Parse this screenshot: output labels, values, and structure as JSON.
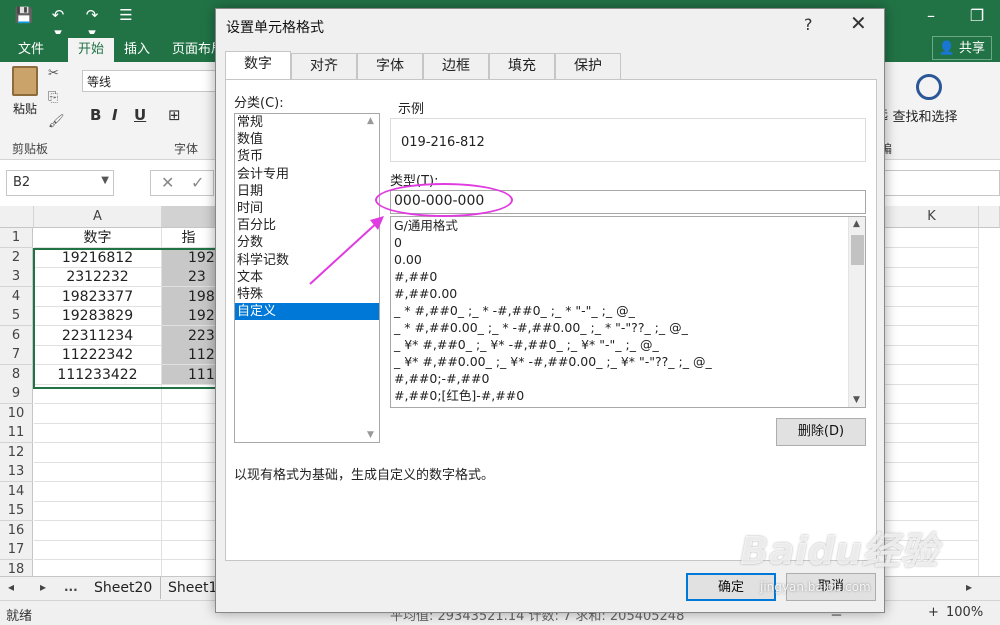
{
  "excel": {
    "quick_access": [
      "💾",
      "↶ ▾",
      "↷ ▾",
      "☰"
    ],
    "tabs": [
      "文件",
      "开始",
      "插入",
      "页面布局"
    ],
    "share_label": "共享",
    "ribbon": {
      "paste_label": "粘贴",
      "clipboard_label": "剪贴板",
      "font_name": "等线",
      "font_group_label": "字体",
      "bold": "B",
      "italic": "I",
      "underline": "U",
      "find_label": "查找和选择",
      "left_cut_label": "选",
      "edit_group_label": "编"
    },
    "name_box": "B2",
    "column_headers": [
      "A",
      "",
      "K"
    ],
    "row_numbers": [
      "1",
      "2",
      "3",
      "4",
      "5",
      "6",
      "7",
      "8",
      "9",
      "10",
      "11",
      "12",
      "13",
      "14",
      "15",
      "16",
      "17",
      "18"
    ],
    "col_a": [
      "数字",
      "19216812",
      "2312232",
      "19823377",
      "19283829",
      "22311234",
      "11222342",
      "111233422"
    ],
    "col_b": [
      "指",
      "192",
      "23",
      "198",
      "192",
      "223",
      "112",
      "111"
    ],
    "sheet_nav": [
      "◂",
      "▸",
      "..."
    ],
    "sheet_tabs": [
      "Sheet20",
      "Sheet1"
    ],
    "status_ready": "就绪",
    "status_stats": "平均值: 29343521.14    计数: 7    求和: 205405248",
    "zoom": "100%",
    "zoom_minus": "－",
    "zoom_plus": "+"
  },
  "dialog": {
    "title": "设置单元格格式",
    "help": "?",
    "close": "✕",
    "tabs": [
      "数字",
      "对齐",
      "字体",
      "边框",
      "填充",
      "保护"
    ],
    "category_label": "分类(C):",
    "categories": [
      "常规",
      "数值",
      "货币",
      "会计专用",
      "日期",
      "时间",
      "百分比",
      "分数",
      "科学记数",
      "文本",
      "特殊",
      "自定义"
    ],
    "selected_category": "自定义",
    "sample_label": "示例",
    "sample_value": "019-216-812",
    "type_label": "类型(T):",
    "type_value": "000-000-000",
    "format_list": [
      "G/通用格式",
      "0",
      "0.00",
      "#,##0",
      "#,##0.00",
      "_ * #,##0_ ;_ * -#,##0_ ;_ * \"-\"_ ;_ @_",
      "_ * #,##0.00_ ;_ * -#,##0.00_ ;_ * \"-\"??_ ;_ @_",
      "_ ¥* #,##0_ ;_ ¥* -#,##0_ ;_ ¥* \"-\"_ ;_ @_",
      "_ ¥* #,##0.00_ ;_ ¥* -#,##0.00_ ;_ ¥* \"-\"??_ ;_ @_",
      "#,##0;-#,##0",
      "#,##0;[红色]-#,##0"
    ],
    "delete_button": "删除(D)",
    "description": "以现有格式为基础，生成自定义的数字格式。",
    "ok_button": "确定",
    "cancel_button": "取消"
  },
  "watermark": {
    "brand": "Baidu经验",
    "url": "jingyan.baidu.com"
  },
  "colors": {
    "excel_green": "#217346",
    "annotation_magenta": "#e03be0",
    "selection_blue": "#0078d7"
  }
}
